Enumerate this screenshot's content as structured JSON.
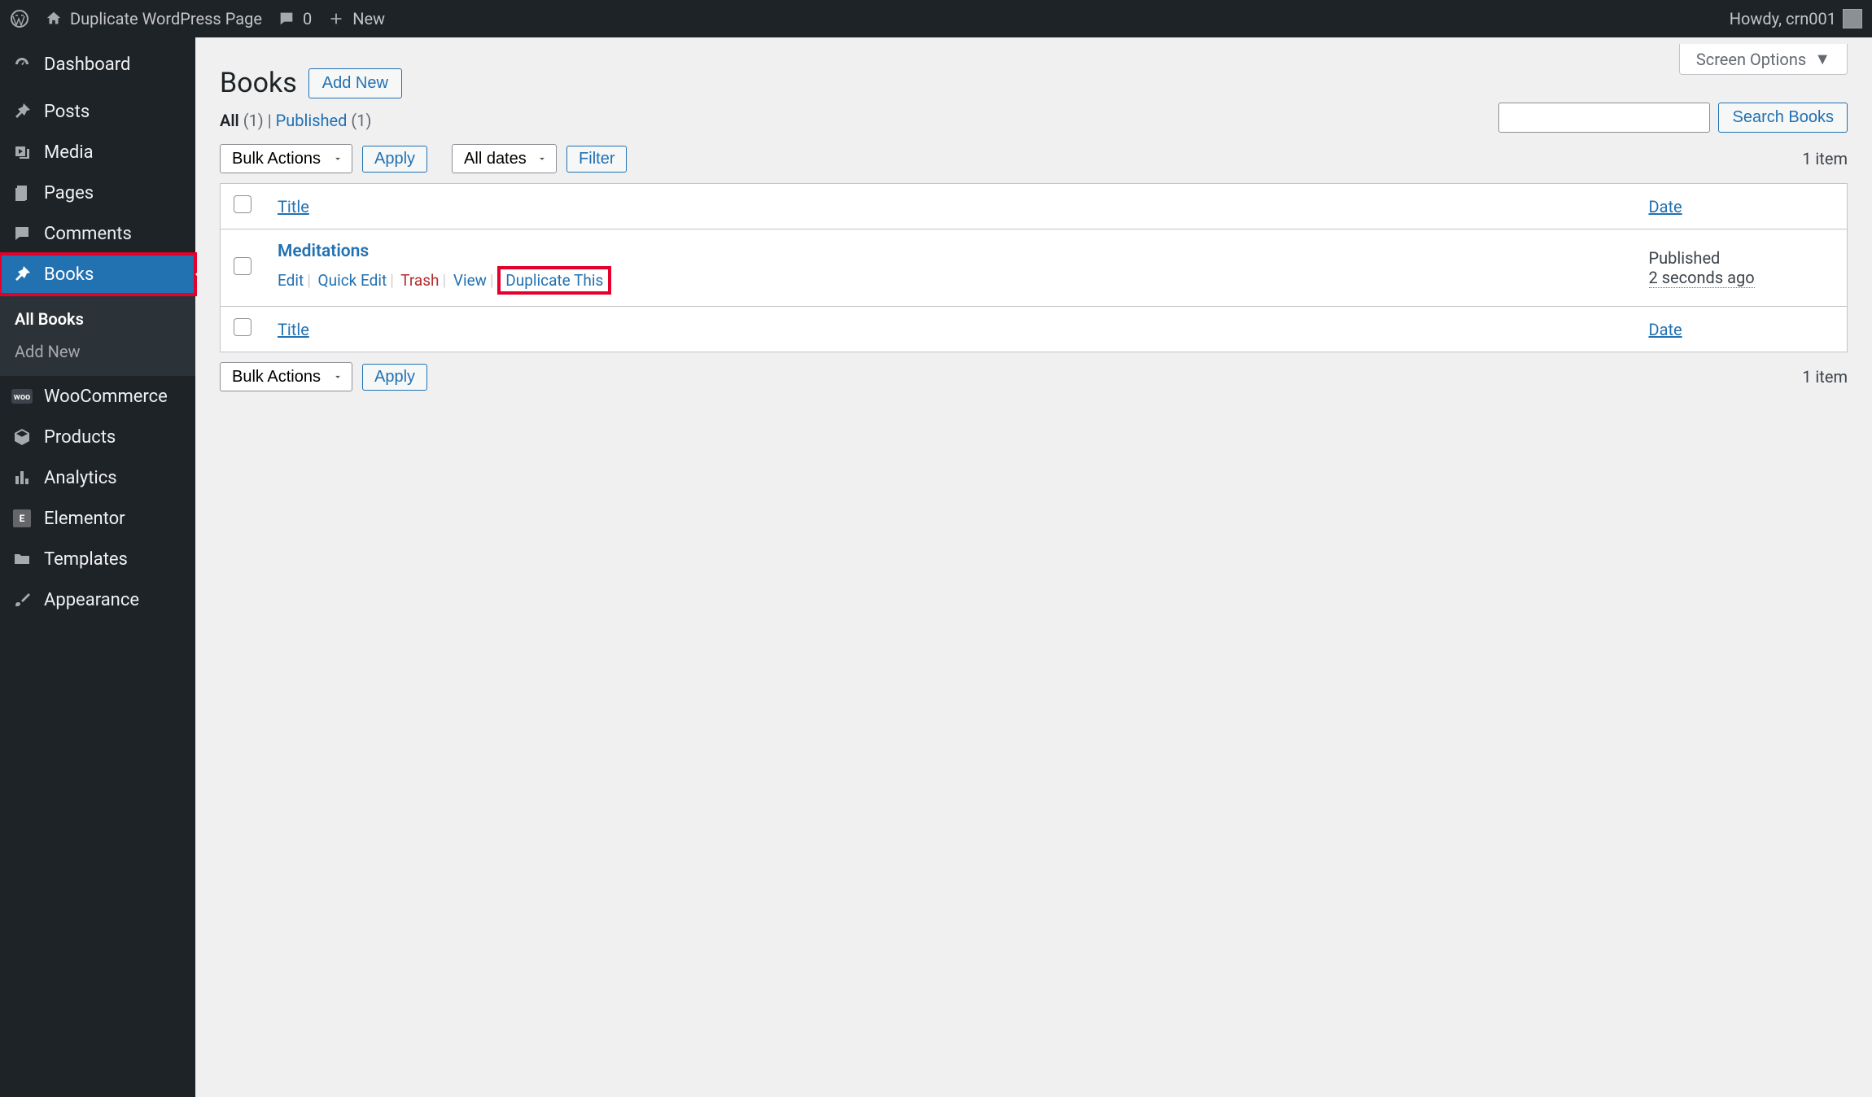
{
  "adminbar": {
    "site_title": "Duplicate WordPress Page",
    "comments_count": "0",
    "new_label": "New",
    "howdy": "Howdy, crn001"
  },
  "sidebar": {
    "dashboard": "Dashboard",
    "posts": "Posts",
    "media": "Media",
    "pages": "Pages",
    "comments": "Comments",
    "books": "Books",
    "submenu": {
      "all": "All Books",
      "add": "Add New"
    },
    "woocommerce": "WooCommerce",
    "products": "Products",
    "analytics": "Analytics",
    "elementor": "Elementor",
    "templates": "Templates",
    "appearance": "Appearance"
  },
  "screen_options": "Screen Options",
  "heading": "Books",
  "add_new_btn": "Add New",
  "filters": {
    "all_label": "All",
    "all_count": "(1)",
    "sep": " | ",
    "published_label": "Published",
    "published_count": "(1)"
  },
  "bulk_actions": "Bulk Actions",
  "apply": "Apply",
  "all_dates": "All dates",
  "filter": "Filter",
  "search_btn": "Search Books",
  "item_count": "1 item",
  "columns": {
    "title": "Title",
    "date": "Date"
  },
  "row": {
    "title": "Meditations",
    "actions": {
      "edit": "Edit",
      "quick_edit": "Quick Edit",
      "trash": "Trash",
      "view": "View",
      "duplicate": "Duplicate This"
    },
    "date_status": "Published",
    "date_time": "2 seconds ago"
  }
}
